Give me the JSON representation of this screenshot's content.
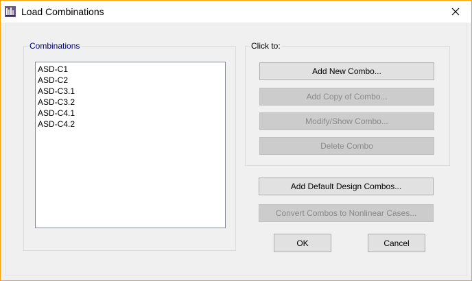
{
  "window": {
    "title": "Load Combinations",
    "app_icon": "etabs-app-icon",
    "close_icon": "close-icon"
  },
  "combinations": {
    "label": "Combinations",
    "items": [
      "ASD-C1",
      "ASD-C2",
      "ASD-C3.1",
      "ASD-C3.2",
      "ASD-C4.1",
      "ASD-C4.2"
    ]
  },
  "click_to": {
    "label": "Click to:",
    "add_new_label": "Add New Combo...",
    "add_copy_label": "Add Copy of Combo...",
    "modify_label": "Modify/Show Combo...",
    "delete_label": "Delete Combo"
  },
  "actions": {
    "add_default_label": "Add Default Design Combos...",
    "convert_label": "Convert Combos to Nonlinear Cases...",
    "ok_label": "OK",
    "cancel_label": "Cancel"
  },
  "colors": {
    "group_label": "#000080",
    "disabled_text": "#8a8a8a",
    "button_face": "#e1e1e1",
    "window_border": "#ffa000"
  }
}
